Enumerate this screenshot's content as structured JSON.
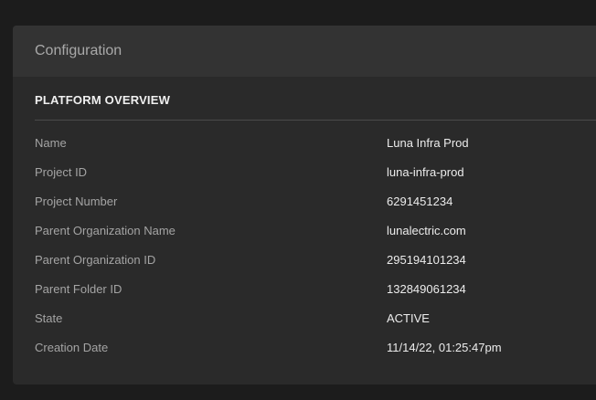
{
  "card": {
    "title": "Configuration"
  },
  "section": {
    "title": "PLATFORM OVERVIEW",
    "rows": [
      {
        "label": "Name",
        "value": "Luna Infra Prod"
      },
      {
        "label": "Project ID",
        "value": "luna-infra-prod"
      },
      {
        "label": "Project Number",
        "value": "6291451234"
      },
      {
        "label": "Parent Organization Name",
        "value": "lunalectric.com"
      },
      {
        "label": "Parent Organization ID",
        "value": "295194101234"
      },
      {
        "label": "Parent Folder ID",
        "value": "132849061234"
      },
      {
        "label": "State",
        "value": "ACTIVE"
      },
      {
        "label": "Creation Date",
        "value": "11/14/22, 01:25:47pm"
      }
    ]
  }
}
